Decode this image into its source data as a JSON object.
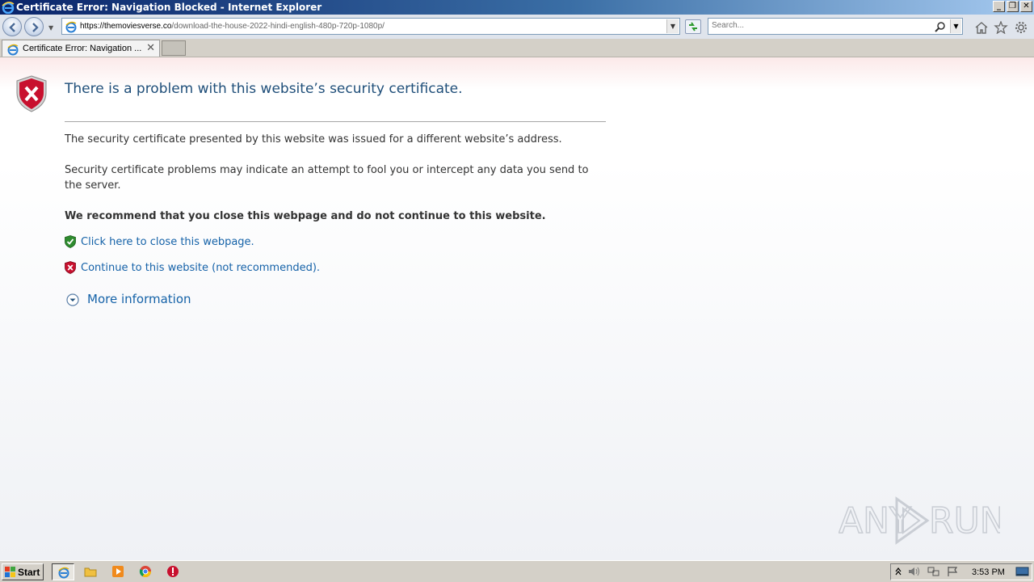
{
  "window": {
    "title": "Certificate Error: Navigation Blocked - Internet Explorer",
    "buttons": {
      "minimize": "_",
      "restore": "❐",
      "close": "✕"
    }
  },
  "navbar": {
    "url_host": "https://themoviesverse.co",
    "url_path": "/download-the-house-2022-hindi-english-480p-720p-1080p/",
    "search_placeholder": "Search..."
  },
  "tabs": [
    {
      "label": "Certificate Error: Navigation ...",
      "close": "✕"
    }
  ],
  "content": {
    "headline": "There is a problem with this website’s security certificate.",
    "paragraph1": "The security certificate presented by this website was issued for a different website’s address.",
    "paragraph2": "Security certificate problems may indicate an attempt to fool you or intercept any data you send to the server.",
    "recommend": "We recommend that you close this webpage and do not continue to this website.",
    "close_link": "Click here to close this webpage.",
    "continue_link": "Continue to this website (not recommended).",
    "more_info": "More information"
  },
  "watermark": {
    "text": "ANY RUN"
  },
  "taskbar": {
    "start_label": "Start",
    "clock": "3:53 PM"
  },
  "colors": {
    "headline": "#1f4e79",
    "link": "#1562a8",
    "shield_red": "#c8102e",
    "shield_green": "#2e8b2e"
  }
}
